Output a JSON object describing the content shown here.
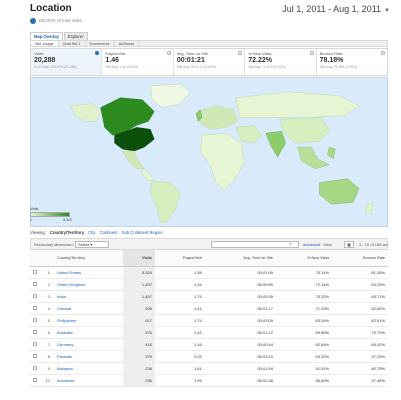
{
  "header": {
    "title": "Location",
    "percent_line": "100.00% of total visits",
    "date_range": "Jul 1, 2011 - Aug 1, 2011"
  },
  "view_tabs": [
    "Map Overlay",
    "Explorer"
  ],
  "metric_tabs": [
    "Site Usage",
    "Goal Set 1",
    "Ecommerce",
    "AdSense"
  ],
  "scorecards": [
    {
      "label": "Visits",
      "value": "20,288",
      "sub": "% of Total: 100.00% (20,288)"
    },
    {
      "label": "Pages/Visit",
      "value": "1.46",
      "sub": "Site Avg: 1.46 (0.00%)"
    },
    {
      "label": "Avg. Time on Site",
      "value": "00:01:21",
      "sub": "Site Avg: 00:01:21 (0.00%)"
    },
    {
      "label": "% New Visits",
      "value": "72.22%",
      "sub": "Site Avg: 72.20% (0.02%)"
    },
    {
      "label": "Bounce Rate",
      "value": "78.18%",
      "sub": "Site Avg: 78.18% (0.00%)"
    }
  ],
  "legend": {
    "label": "Visits",
    "min": "1",
    "max": "5,320",
    "color_low": "#e6f5d4",
    "color_high": "#2d8a1f"
  },
  "viewing": {
    "label": "Viewing:",
    "options": [
      "Country/Territory",
      "City",
      "Continent",
      "Sub Continent Region"
    ]
  },
  "controls": {
    "secondary_dimension_label": "Secondary dimension:",
    "select_label": "Select",
    "advanced": "advanced",
    "views": "View",
    "range": "1 - 10 of 156"
  },
  "table": {
    "headers": [
      "Country/Territory",
      "Visits",
      "Pages/Visit",
      "Avg. Time on Site",
      "% New Visits",
      "Bounce Rate"
    ],
    "rows": [
      {
        "rank": "1.",
        "country": "United States",
        "visits": "5,320",
        "ppv": "1.38",
        "time": "00:01:09",
        "new": "75.14%",
        "bounce": "81.28%"
      },
      {
        "rank": "2.",
        "country": "United Kingdom",
        "visits": "1,497",
        "ppv": "1.34",
        "time": "00:00:59",
        "new": "72.14%",
        "bounce": "83.23%"
      },
      {
        "rank": "3.",
        "country": "India",
        "visits": "1,457",
        "ppv": "1.75",
        "time": "00:03:35",
        "new": "75.32%",
        "bounce": "65.71%"
      },
      {
        "rank": "4.",
        "country": "Canada",
        "visits": "938",
        "ppv": "1.41",
        "time": "00:01:17",
        "new": "71.43%",
        "bounce": "82.62%"
      },
      {
        "rank": "5.",
        "country": "Philippines",
        "visits": "617",
        "ppv": "1.74",
        "time": "00:03:09",
        "new": "63.04%",
        "bounce": "62.91%"
      },
      {
        "rank": "6.",
        "country": "Australia",
        "visits": "576",
        "ppv": "1.42",
        "time": "00:01:12",
        "new": "69.85%",
        "bounce": "79.79%"
      },
      {
        "rank": "7.",
        "country": "Germany",
        "visits": "416",
        "ppv": "1.16",
        "time": "00:00:44",
        "new": "62.64%",
        "bounce": "89.42%"
      },
      {
        "rank": "8.",
        "country": "Pakistan",
        "visits": "379",
        "ppv": "2.09",
        "time": "00:03:19",
        "new": "63.32%",
        "bounce": "47.23%"
      },
      {
        "rank": "9.",
        "country": "Malaysia",
        "visits": "238",
        "ppv": "1.61",
        "time": "00:01:54",
        "new": "51.51%",
        "bounce": "80.75%"
      },
      {
        "rank": "10.",
        "country": "Indonesia",
        "visits": "236",
        "ppv": "1.95",
        "time": "00:02:38",
        "new": "55.69%",
        "bounce": "47.46%"
      }
    ]
  }
}
